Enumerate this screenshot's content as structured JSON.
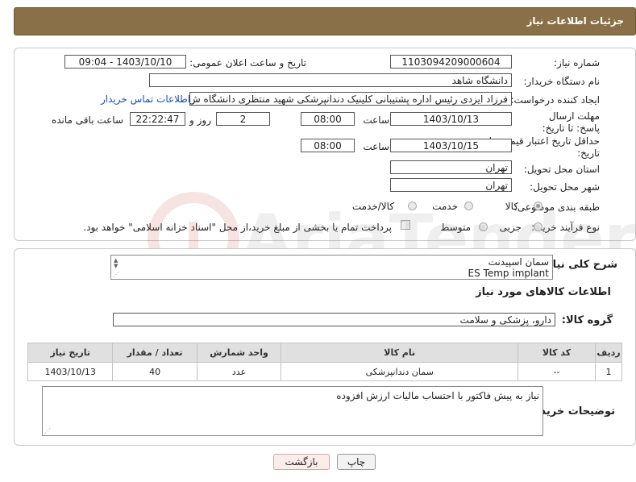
{
  "header": {
    "title": "جزئیات اطلاعات نیاز"
  },
  "fields": {
    "need_number_label": "شماره نیاز:",
    "need_number": "1103094209000604",
    "announce_label": "تاریخ و ساعت اعلان عمومی:",
    "announce_value": "1403/10/10 - 09:04",
    "buyer_org_label": "نام دستگاه خریدار:",
    "buyer_org": "دانشگاه شاهد",
    "requester_label": "ایجاد کننده درخواست:",
    "requester": "فرزاد ایزدی رئیس اداره پشتیبانی کلینیک دندانپزشکی شهید منتظری دانشگاه ش",
    "contact_link": "اطلاعات تماس خریدار",
    "deadline_label": "مهلت ارسال پاسخ: تا تاریخ:",
    "deadline_date": "1403/10/13",
    "time_label": "ساعت",
    "deadline_time": "08:00",
    "days": "2",
    "days_label": "روز و",
    "remaining_time": "22:22:47",
    "remaining_label": "ساعت باقی مانده",
    "price_validity_label": "حداقل تاریخ اعتبار قیمت: تا تاریخ:",
    "price_validity_date": "1403/10/15",
    "price_validity_time": "08:00",
    "province_label": "استان محل تحویل:",
    "province": "تهران",
    "city_label": "شهر محل تحویل:",
    "city": "تهران",
    "category_label": "طبقه بندی موضوعی:",
    "category_options": [
      "کالا",
      "خدمت",
      "کالا/خدمت"
    ],
    "category_selected": "کالا",
    "process_label": "نوع فرآیند خرید :",
    "process_options": [
      "جزیی",
      "متوسط"
    ],
    "payment_note": "پرداخت تمام یا بخشی از مبلغ خرید،از محل \"اسناد خزانه اسلامی\" خواهد بود."
  },
  "description": {
    "label": "شرح کلی نیاز:",
    "line1": "سمان اسپیدنت",
    "line2": "ES Temp implant"
  },
  "goods_info": {
    "title": "اطلاعات کالاهای مورد نیاز",
    "group_label": "گروه کالا:",
    "group_value": "دارو، پزشکی و سلامت"
  },
  "table": {
    "headers": [
      "ردیف",
      "کد کالا",
      "نام کالا",
      "واحد شمارش",
      "تعداد / مقدار",
      "تاریخ نیاز"
    ],
    "rows": [
      [
        "1",
        "--",
        "سمان دندانپزشکی",
        "عدد",
        "40",
        "1403/10/13"
      ]
    ]
  },
  "buyer_notes": {
    "label": "توضیحات خریدار:",
    "text": "نیاز به پیش فاکتور با احتساب مالیات ارزش افزوده"
  },
  "buttons": {
    "print": "چاپ",
    "back": "بازگشت"
  },
  "watermark": {
    "text": "AriaTender.net"
  }
}
